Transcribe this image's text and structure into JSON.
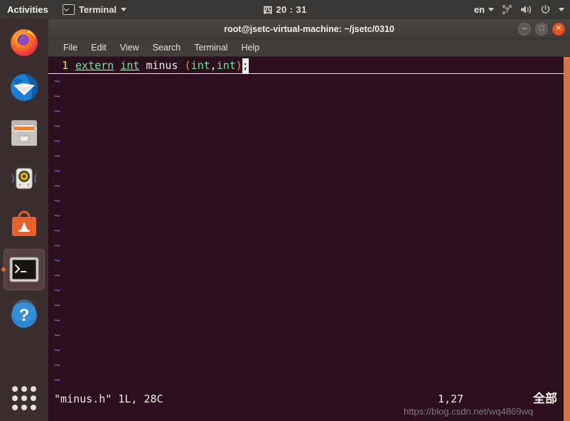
{
  "top_panel": {
    "activities_label": "Activities",
    "app_menu_label": "Terminal",
    "app_menu_icon": "terminal-icon",
    "clock_day": "四",
    "clock_time": "20 : 31",
    "language_label": "en",
    "icons": [
      "accessibility-icon",
      "volume-icon",
      "power-icon",
      "chevron-down-icon"
    ]
  },
  "dock": {
    "items": [
      {
        "name": "firefox",
        "label": "Firefox Web Browser",
        "running": false
      },
      {
        "name": "thunderbird",
        "label": "Thunderbird Mail",
        "running": false
      },
      {
        "name": "files",
        "label": "Files",
        "running": false
      },
      {
        "name": "rhythmbox",
        "label": "Rhythmbox",
        "running": false
      },
      {
        "name": "ubuntu-software",
        "label": "Ubuntu Software",
        "running": false
      },
      {
        "name": "terminal",
        "label": "Terminal",
        "running": true
      },
      {
        "name": "help",
        "label": "Help",
        "running": false
      }
    ],
    "show_apps_label": "Show Applications"
  },
  "window": {
    "title": "root@jsetc-virtual-machine: ~/jsetc/0310",
    "controls": {
      "minimize": "–",
      "maximize": "□",
      "close": "✕"
    },
    "menu": [
      "File",
      "Edit",
      "View",
      "Search",
      "Terminal",
      "Help"
    ]
  },
  "editor": {
    "line_number": "1",
    "tokens": [
      {
        "text": "extern",
        "kind": "keyword"
      },
      {
        "text": " ",
        "kind": "space"
      },
      {
        "text": "int",
        "kind": "keyword"
      },
      {
        "text": " ",
        "kind": "space"
      },
      {
        "text": "minus",
        "kind": "identifier"
      },
      {
        "text": " ",
        "kind": "space"
      },
      {
        "text": "(",
        "kind": "paren"
      },
      {
        "text": "int",
        "kind": "type"
      },
      {
        "text": ",",
        "kind": "punct"
      },
      {
        "text": "int",
        "kind": "type"
      },
      {
        "text": ")",
        "kind": "paren"
      }
    ],
    "cursor_char": ";",
    "full_line": "extern int minus (int,int);",
    "tilde_char": "~",
    "tilde_count": 21,
    "status": {
      "file_info": "\"minus.h\" 1L, 28C",
      "position": "1,27",
      "percent": "全部"
    }
  },
  "watermark": "https://blog.csdn.net/wq4869wq",
  "colors": {
    "desktop_bg": "#3d2b2b",
    "panel_bg": "#3a3836",
    "dock_bg": "#3b2e2e",
    "terminal_bg": "#2b0f1f",
    "titlebar_bg": "#4a4643",
    "keyword_green": "#6fe59a",
    "linenum_yellow": "#e8e34a",
    "paren_orange": "#f08a5d",
    "tilde_blue": "#6f77e0",
    "scrollbar_orange": "#d9733f",
    "close_button": "#e2561d"
  }
}
